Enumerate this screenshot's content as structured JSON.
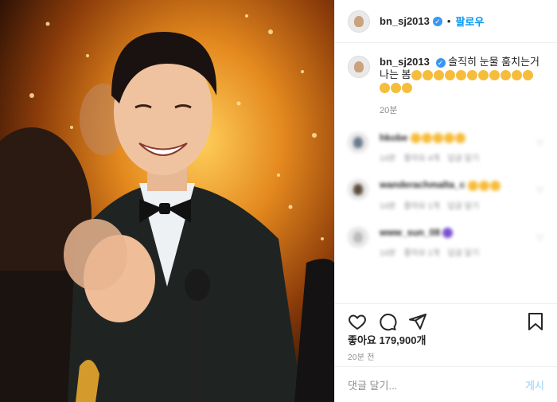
{
  "post": {
    "username": "bn_sj2013",
    "follow_label": "팔로우",
    "caption_text": "솔직히 눈물 훔치는거 나는 봄",
    "caption_time": "20분",
    "likes": "좋아요 179,900개",
    "age": "20분 전",
    "comment_placeholder": "댓글 달기...",
    "post_button": "게시"
  },
  "comments": [
    {
      "username": "hkobe",
      "text": "",
      "time": "14분",
      "likes": "좋아요 4개",
      "reply": "답글 달기"
    },
    {
      "username": "wanderachmalta_c",
      "text": "",
      "time": "14분",
      "likes": "좋아요 1개",
      "reply": "답글 달기"
    },
    {
      "username": "www_sun_08",
      "text": "",
      "time": "14분",
      "likes": "좋아요 1개",
      "reply": "답글 달기"
    }
  ],
  "icons": {
    "like": "heart-icon",
    "comment": "comment-icon",
    "share": "paper-plane-icon",
    "save": "bookmark-icon"
  }
}
